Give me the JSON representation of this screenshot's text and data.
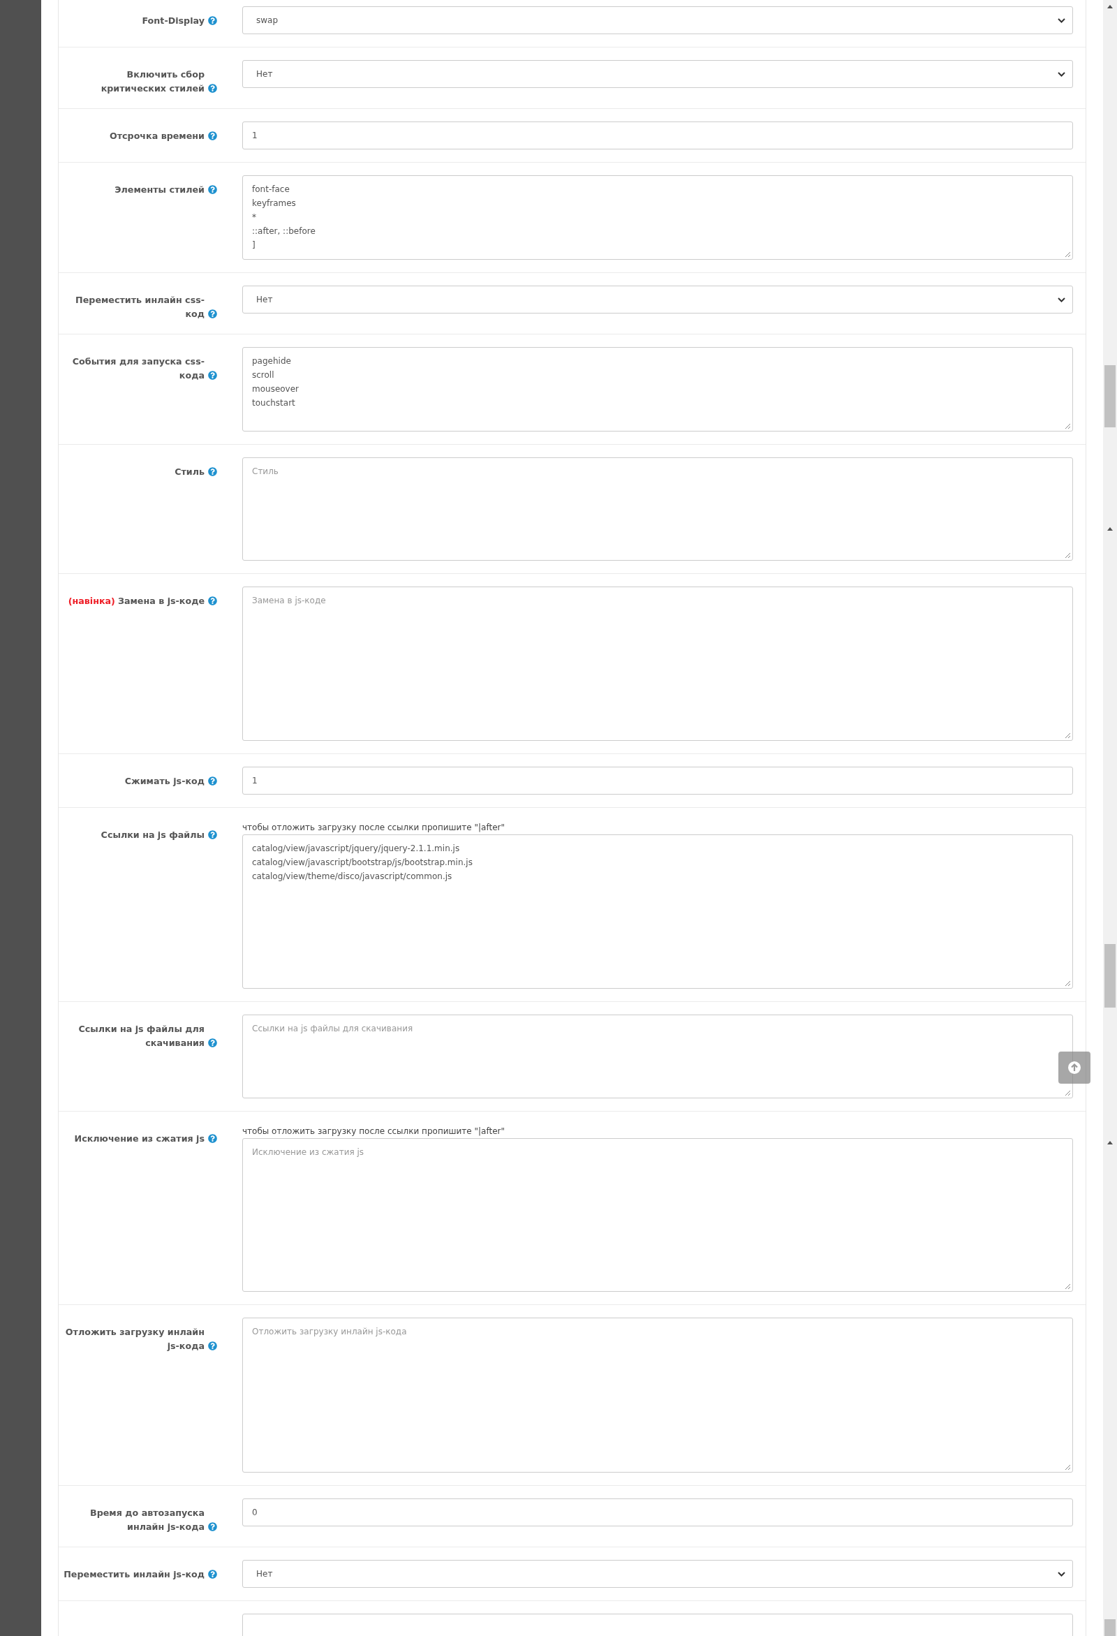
{
  "settings_form": {
    "rows": [
      {
        "label": "Font-Display",
        "help": true,
        "kind": "select",
        "value": "swap"
      },
      {
        "label": "Включить сбор критических стилей",
        "help": true,
        "kind": "select",
        "value": "Нет"
      },
      {
        "label": "Отсрочка времени",
        "help": true,
        "kind": "input",
        "value": "1"
      },
      {
        "label": "Элементы стилей",
        "help": true,
        "kind": "textarea",
        "lines": [
          "font-face",
          "keyframes",
          "*",
          "::after, ::before",
          "]"
        ]
      },
      {
        "label": "Переместить инлайн css-код",
        "help": true,
        "kind": "select",
        "value": "Нет"
      },
      {
        "label": "События для запуска css-кода",
        "help": true,
        "kind": "textarea",
        "lines": [
          "pagehide",
          "scroll",
          "mouseover",
          "touchstart"
        ]
      },
      {
        "label": "Стиль",
        "help": true,
        "kind": "textarea",
        "placeholder": "Стиль"
      },
      {
        "tag": "(навінка)",
        "label": "Замена в js-коде",
        "help": true,
        "kind": "textarea",
        "placeholder": "Замена в js-коде"
      },
      {
        "label": "Сжимать js-код",
        "help": true,
        "kind": "input",
        "value": "1"
      },
      {
        "label": "Ссылки на js файлы",
        "help": true,
        "kind": "textarea",
        "hint": "чтобы отложить загрузку после ссылки пропишите \"|after\"",
        "lines": [
          "catalog/view/javascript/jquery/jquery-2.1.1.min.js",
          "catalog/view/javascript/bootstrap/js/bootstrap.min.js",
          "catalog/view/theme/disco/javascript/common.js"
        ]
      },
      {
        "label": "Ссылки на js файлы для скачивания",
        "help": true,
        "kind": "textarea",
        "placeholder": "Ссылки на js файлы для скачивания"
      },
      {
        "label": "Исключение из сжатия js",
        "help": true,
        "kind": "textarea",
        "hint": "чтобы отложить загрузку после ссылки пропишите \"|after\"",
        "placeholder": "Исключение из сжатия js"
      },
      {
        "label": "Отложить загрузку инлайн js-кода",
        "help": true,
        "kind": "textarea",
        "placeholder": "Отложить загрузку инлайн js-кода"
      },
      {
        "label": "Время до автозапуска инлайн js-кода",
        "help": true,
        "kind": "input",
        "value": "0"
      },
      {
        "label": "Переместить инлайн js-код",
        "help": true,
        "kind": "select",
        "value": "Нет"
      },
      {
        "help": false,
        "kind": "input"
      }
    ]
  }
}
